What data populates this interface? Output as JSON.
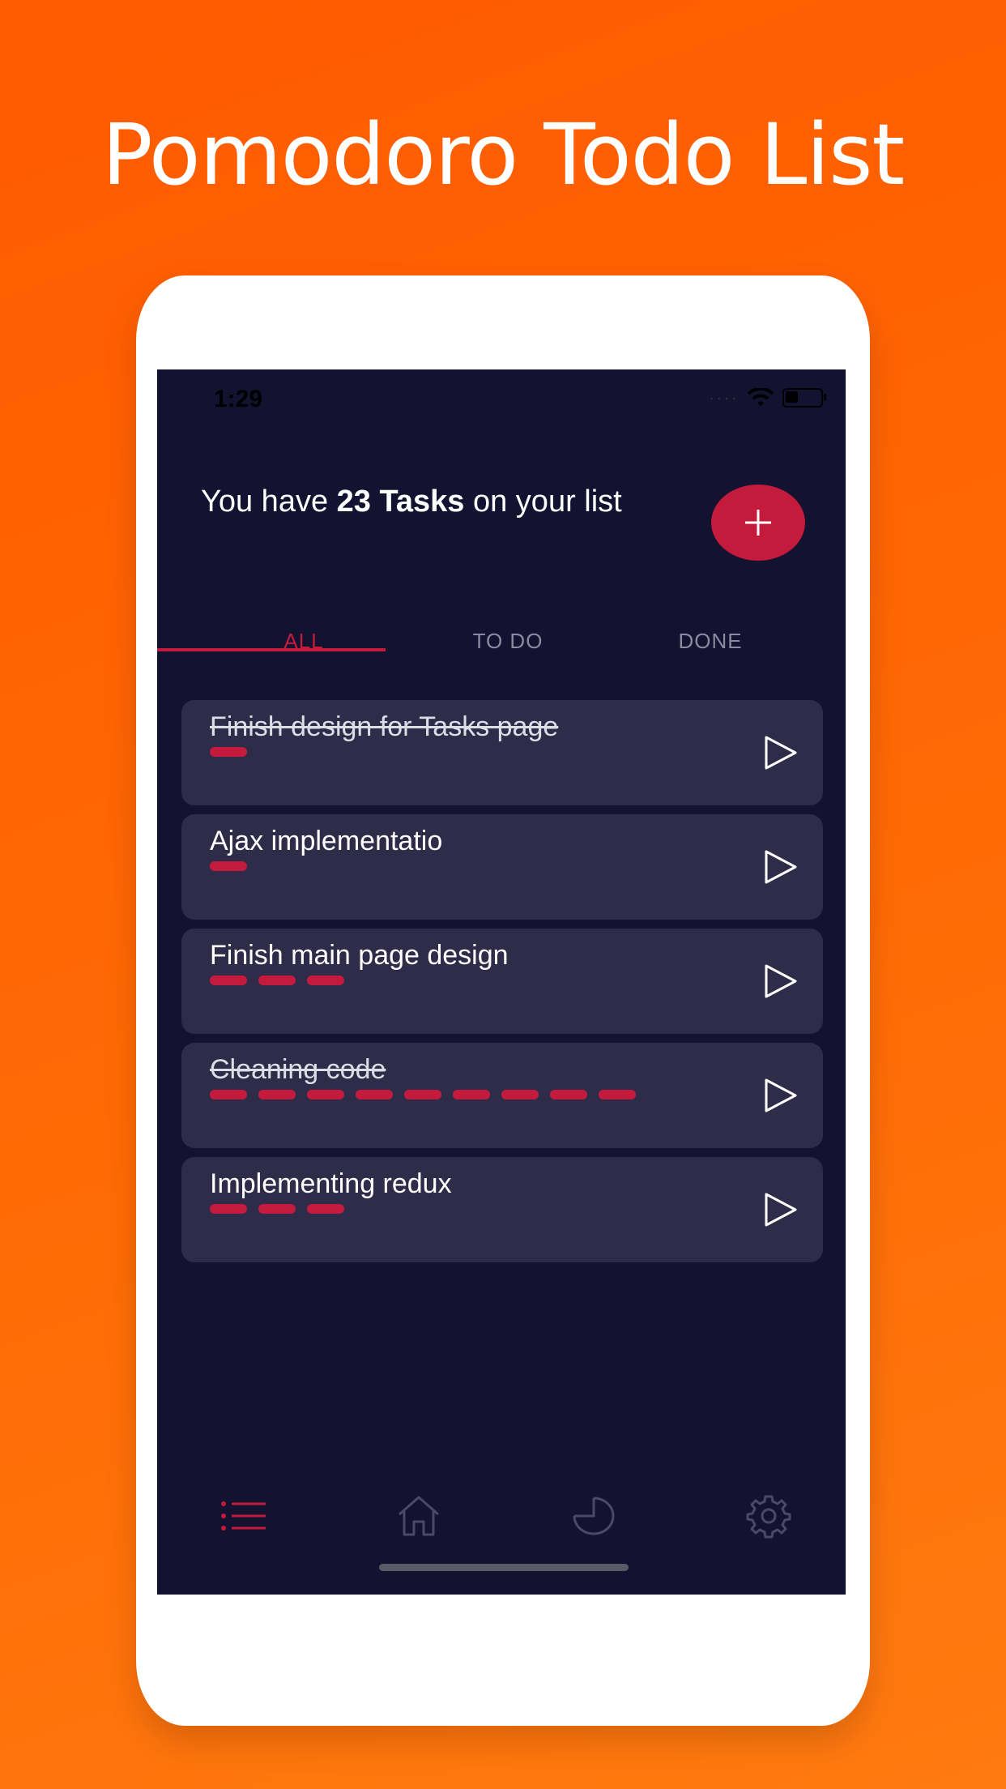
{
  "promo": {
    "title": "Pomodoro Todo List"
  },
  "status_bar": {
    "time": "1:29",
    "battery_level": 0.35
  },
  "header": {
    "prefix": "You have ",
    "count_text": "23 Tasks",
    "suffix": " on your list"
  },
  "add_button": {
    "icon": "plus-icon"
  },
  "tabs": [
    {
      "label": "ALL",
      "active": true
    },
    {
      "label": "TO DO",
      "active": false
    },
    {
      "label": "DONE",
      "active": false
    }
  ],
  "tasks": [
    {
      "title": "Finish design for Tasks page",
      "done": true,
      "pomodoros": 1
    },
    {
      "title": "Ajax implementatio",
      "done": false,
      "pomodoros": 1
    },
    {
      "title": "Finish main page design",
      "done": false,
      "pomodoros": 3
    },
    {
      "title": "Cleaning code",
      "done": true,
      "pomodoros": 9
    },
    {
      "title": "Implementing redux",
      "done": false,
      "pomodoros": 3
    }
  ],
  "bottom_nav": [
    {
      "icon": "list-icon",
      "active": true
    },
    {
      "icon": "home-icon",
      "active": false
    },
    {
      "icon": "pie-chart-icon",
      "active": false
    },
    {
      "icon": "gear-icon",
      "active": false
    }
  ],
  "colors": {
    "accent": "#c41a3c",
    "background": "#131230",
    "card": "#2f2c4a",
    "promo_background": "#ff5a00",
    "inactive": "#8a8aa0"
  }
}
